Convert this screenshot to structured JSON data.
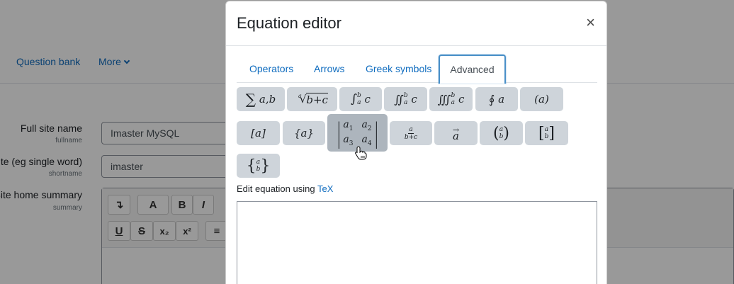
{
  "background": {
    "nav": {
      "question_bank": "Question bank",
      "more": "More"
    },
    "fields": [
      {
        "label": "Full site name",
        "sublabel": "fullname",
        "value": "Imaster MySQL"
      },
      {
        "label": "site (eg single word)",
        "sublabel": "shortname",
        "value": "imaster"
      },
      {
        "label": "Site home summary",
        "sublabel": "summary"
      }
    ],
    "editor": {
      "row1": [
        "↴",
        "A",
        "B",
        "I"
      ],
      "row2": [
        "U",
        "S",
        "x₂",
        "x²",
        "≡"
      ]
    }
  },
  "modal": {
    "title": "Equation editor",
    "close": "×",
    "tabs": [
      "Operators",
      "Arrows",
      "Greek symbols",
      "Advanced"
    ],
    "active_tab": "Advanced",
    "symbols": {
      "sum": {
        "op": "∑",
        "args": "a,b"
      },
      "sqrt": {
        "index": "a",
        "radicand": "b+c"
      },
      "int": {
        "op": "∫",
        "sup": "b",
        "sub": "a",
        "body": "c"
      },
      "iint": {
        "op": "∬",
        "sup": "b",
        "sub": "a",
        "body": "c"
      },
      "iiint": {
        "op": "∭",
        "sup": "b",
        "sub": "a",
        "body": "c"
      },
      "oint": {
        "op": "∮",
        "body": "a"
      },
      "paren": "(a)",
      "bracket": "[a]",
      "brace": "{a}",
      "matrix": [
        "a1",
        "a2",
        "a3",
        "a4"
      ],
      "frac": {
        "num": "a",
        "den": "b+c"
      },
      "vec": "a",
      "binom": {
        "top": "a",
        "bottom": "b"
      }
    },
    "edit_label": "Edit equation using ",
    "tex_link": "TeX"
  }
}
